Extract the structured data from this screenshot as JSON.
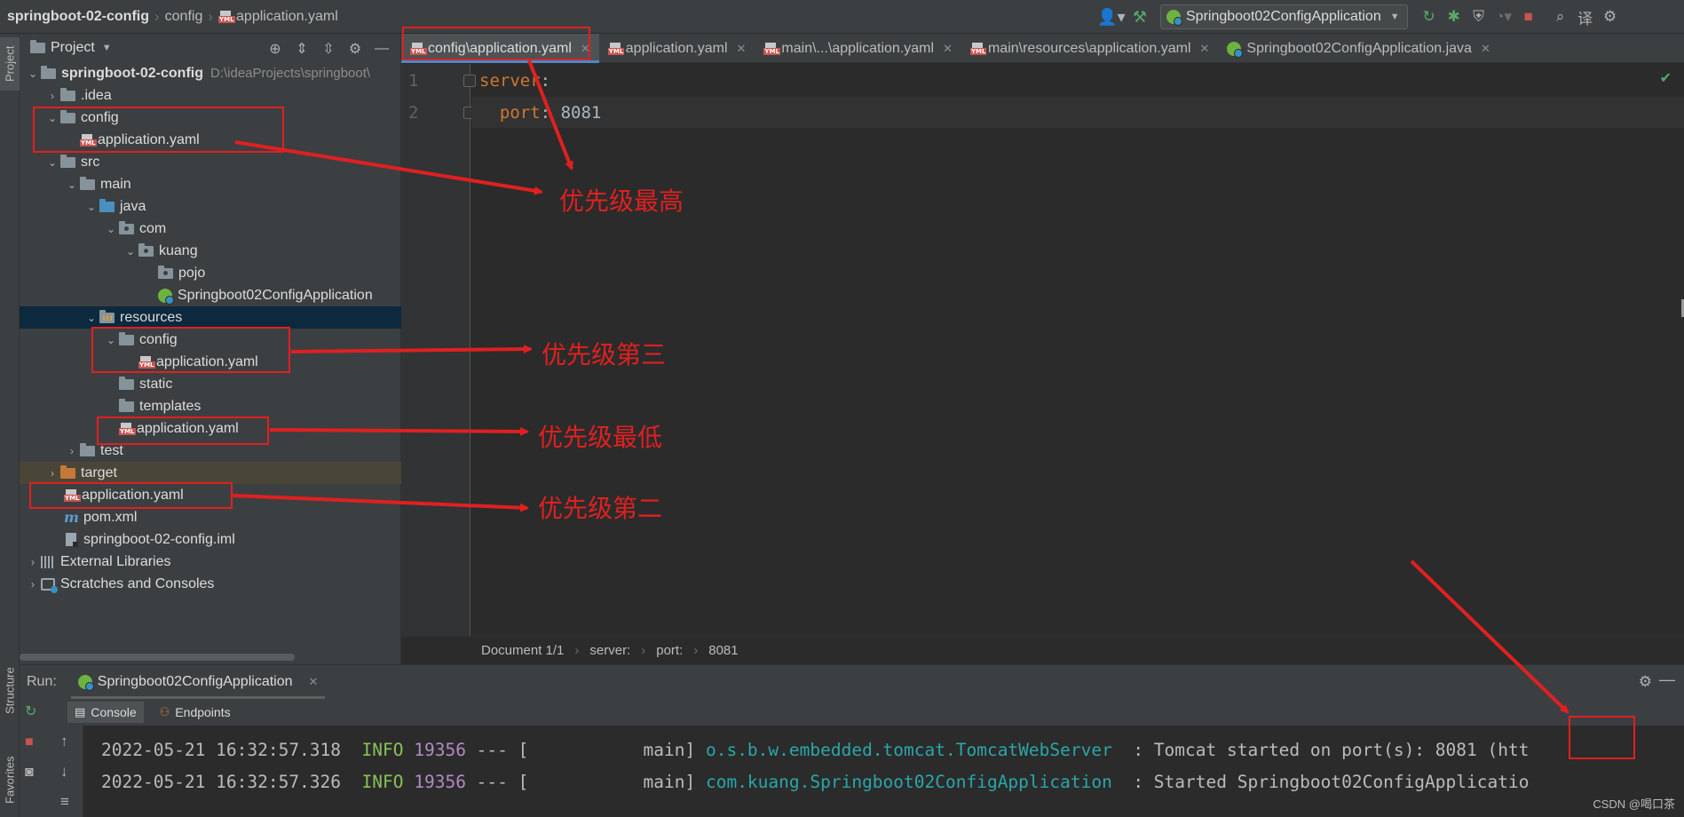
{
  "breadcrumb": {
    "project": "springboot-02-config",
    "folder": "config",
    "file": "application.yaml"
  },
  "toolbar": {
    "run_config": "Springboot02ConfigApplication"
  },
  "side_tabs": {
    "project": "Project",
    "structure": "Structure",
    "favorites": "Favorites"
  },
  "project_panel": {
    "title": "Project",
    "tree": [
      {
        "label": "springboot-02-config",
        "path": "D:\\ideaProjects\\springboot\\"
      },
      {
        "label": ".idea"
      },
      {
        "label": "config"
      },
      {
        "label": "application.yaml"
      },
      {
        "label": "src"
      },
      {
        "label": "main"
      },
      {
        "label": "java"
      },
      {
        "label": "com"
      },
      {
        "label": "kuang"
      },
      {
        "label": "pojo"
      },
      {
        "label": "Springboot02ConfigApplication"
      },
      {
        "label": "resources"
      },
      {
        "label": "config"
      },
      {
        "label": "application.yaml"
      },
      {
        "label": "static"
      },
      {
        "label": "templates"
      },
      {
        "label": "application.yaml"
      },
      {
        "label": "test"
      },
      {
        "label": "target"
      },
      {
        "label": "application.yaml"
      },
      {
        "label": "pom.xml"
      },
      {
        "label": "springboot-02-config.iml"
      },
      {
        "label": "External Libraries"
      },
      {
        "label": "Scratches and Consoles"
      }
    ]
  },
  "tabs": [
    {
      "label": "config\\application.yaml",
      "active": true
    },
    {
      "label": "application.yaml"
    },
    {
      "label": "main\\...\\application.yaml"
    },
    {
      "label": "main\\resources\\application.yaml"
    },
    {
      "label": "Springboot02ConfigApplication.java"
    }
  ],
  "editor": {
    "line_numbers": [
      "1",
      "2"
    ],
    "line1_key": "server",
    "line2_key": "port",
    "line2_value": "8081",
    "colon": ":"
  },
  "editor_breadcrumb": [
    "Document 1/1",
    "server:",
    "port:",
    "8081"
  ],
  "run_panel": {
    "label": "Run:",
    "tab": "Springboot02ConfigApplication",
    "subtabs": [
      "Console",
      "Endpoints"
    ],
    "logs": [
      {
        "ts": "2022-05-21 16:32:57.318",
        "level": "INFO",
        "pid": "19356",
        "mid": " --- [           main] ",
        "cls": "o.s.b.w.embedded.tomcat.TomcatWebServer",
        "msg_pre": "  : Tomcat started on port(s): ",
        "port": "8081",
        "msg_post": " (htt"
      },
      {
        "ts": "2022-05-21 16:32:57.326",
        "level": "INFO",
        "pid": "19356",
        "mid": " --- [           main] ",
        "cls": "com.kuang.Springboot02ConfigApplication",
        "msg_pre": "  : Started Springboot02ConfigApplicatio",
        "port": "",
        "msg_post": ""
      }
    ]
  },
  "annotations": {
    "highest": "优先级最高",
    "third": "优先级第三",
    "lowest": "优先级最低",
    "second": "优先级第二"
  },
  "watermark": "CSDN @喝口茶",
  "colors": {
    "annotation": "#e02020",
    "accent": "#4a88c7",
    "yaml_key": "#cc7832"
  }
}
